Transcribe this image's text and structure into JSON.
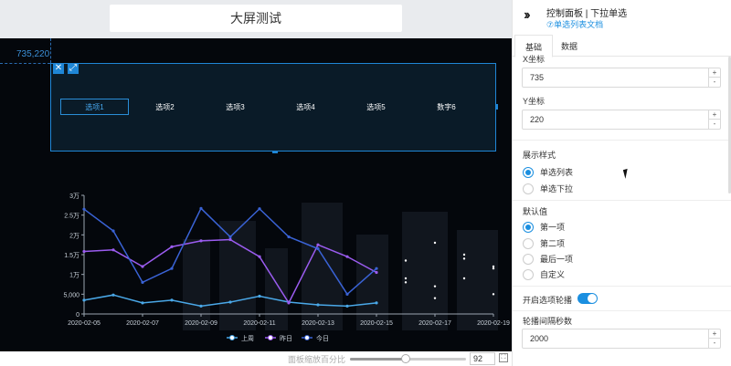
{
  "screen_title": "大屏测试",
  "coord_readout": "735,220",
  "widget": {
    "options": [
      {
        "label": "选项1",
        "active": true
      },
      {
        "label": "选项2",
        "active": false
      },
      {
        "label": "选项3",
        "active": false
      },
      {
        "label": "选项4",
        "active": false
      },
      {
        "label": "选项5",
        "active": false
      },
      {
        "label": "数字6",
        "active": false
      }
    ]
  },
  "chart_data": {
    "type": "line",
    "categories": [
      "2020-02-05",
      "2020-02-06",
      "2020-02-07",
      "2020-02-08",
      "2020-02-09",
      "2020-02-10",
      "2020-02-11",
      "2020-02-12",
      "2020-02-13",
      "2020-02-14",
      "2020-02-15",
      "2020-02-16",
      "2020-02-17",
      "2020-02-18",
      "2020-02-19"
    ],
    "x_tick_labels": [
      "2020-02-05",
      "2020-02-07",
      "2020-02-09",
      "2020-02-11",
      "2020-02-13",
      "2020-02-15",
      "2020-02-17",
      "2020-02-19"
    ],
    "y_tick_labels": [
      "0",
      "5,000",
      "1万",
      "1.5万",
      "2万",
      "2.5万",
      "3万"
    ],
    "ylim": [
      0,
      30000
    ],
    "series": [
      {
        "name": "上周",
        "color": "#4aa8e8",
        "values": [
          3500,
          4800,
          2800,
          3500,
          2000,
          3000,
          4500,
          3000,
          2300,
          2000,
          2800,
          8000,
          4000,
          9000,
          5000
        ]
      },
      {
        "name": "昨日",
        "color": "#9b5cf0",
        "values": [
          15800,
          16200,
          12000,
          17000,
          18500,
          18800,
          14500,
          2800,
          17500,
          14500,
          10500,
          13500,
          18000,
          14000,
          11500
        ]
      },
      {
        "name": "今日",
        "color": "#3a63d6",
        "values": [
          26500,
          21000,
          8000,
          11500,
          26700,
          19500,
          26600,
          19500,
          16500,
          5000,
          11500,
          9000,
          7000,
          15000,
          12000
        ]
      }
    ]
  },
  "zoom": {
    "label": "面板缩放百分比",
    "value": "92",
    "fraction": 0.48
  },
  "panel": {
    "title": "控制面板 | 下拉单选",
    "doc_link": "⑦单选列表文档",
    "tabs": [
      {
        "label": "基础",
        "active": true
      },
      {
        "label": "数据",
        "active": false
      }
    ],
    "x_label": "X坐标",
    "x_value": "735",
    "y_label": "Y坐标",
    "y_value": "220",
    "style_label": "展示样式",
    "style_options": [
      {
        "label": "单选列表",
        "checked": true
      },
      {
        "label": "单选下拉",
        "checked": false
      }
    ],
    "default_label": "默认值",
    "default_options": [
      {
        "label": "第一项",
        "checked": true
      },
      {
        "label": "第二项",
        "checked": false
      },
      {
        "label": "最后一项",
        "checked": false
      },
      {
        "label": "自定义",
        "checked": false
      }
    ],
    "carousel_label": "开启选项轮播",
    "carousel_on": true,
    "interval_label": "轮播间隔秒数",
    "interval_value": "2000",
    "step_up": "+",
    "step_down": "-"
  }
}
